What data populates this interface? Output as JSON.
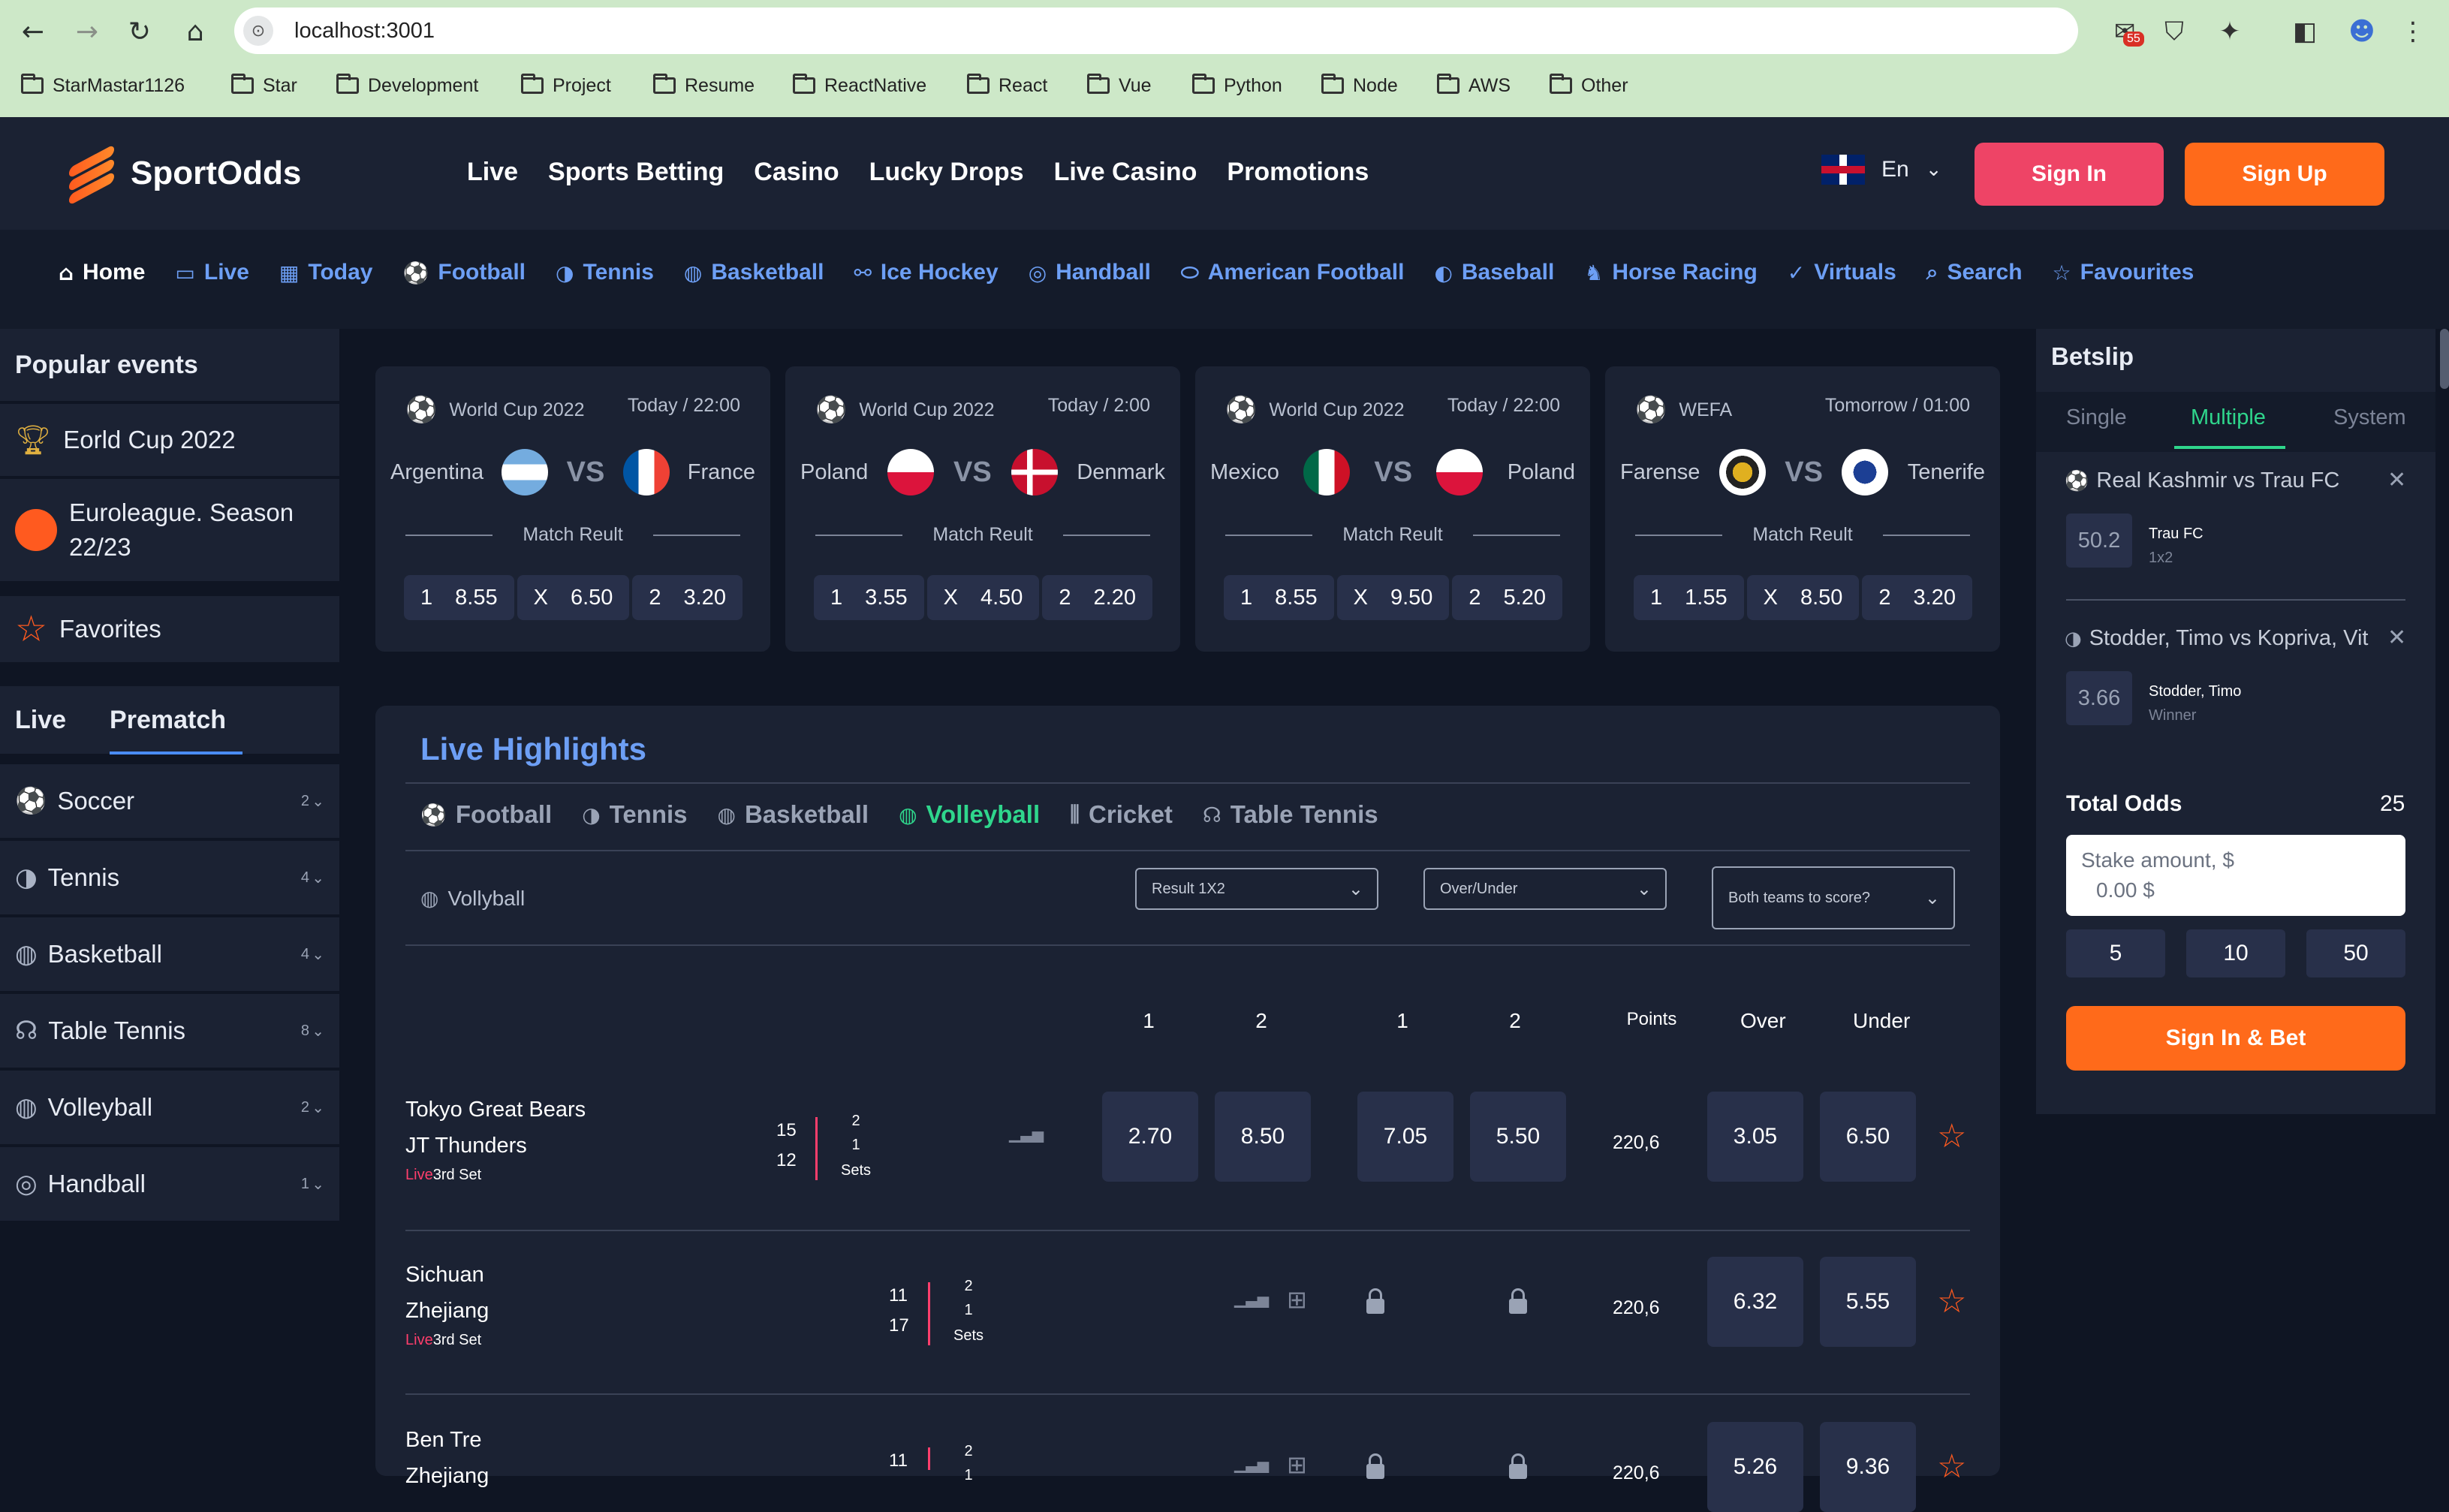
{
  "browser": {
    "url": "localhost:3001",
    "badge": "55",
    "bookmarks": [
      "StarMastar1126",
      "Star",
      "Development",
      "Project",
      "Resume",
      "ReactNative",
      "React",
      "Vue",
      "Python",
      "Node",
      "AWS",
      "Other"
    ]
  },
  "header": {
    "brand": "SportOdds",
    "nav": [
      "Live",
      "Sports Betting",
      "Casino",
      "Lucky Drops",
      "Live Casino",
      "Promotions"
    ],
    "lang": "En",
    "signin": "Sign In",
    "signup": "Sign Up"
  },
  "subnav": [
    {
      "label": "Home",
      "icon": "home-icon",
      "glyph": "⌂"
    },
    {
      "label": "Live",
      "icon": "live-icon",
      "glyph": "▭"
    },
    {
      "label": "Today",
      "icon": "calendar-icon",
      "glyph": "▦"
    },
    {
      "label": "Football",
      "icon": "football-icon",
      "glyph": "⚽"
    },
    {
      "label": "Tennis",
      "icon": "tennis-icon",
      "glyph": "◑"
    },
    {
      "label": "Basketball",
      "icon": "basketball-icon",
      "glyph": "◍"
    },
    {
      "label": "Ice Hockey",
      "icon": "hockey-icon",
      "glyph": "⚯"
    },
    {
      "label": "Handball",
      "icon": "handball-icon",
      "glyph": "◎"
    },
    {
      "label": "American Football",
      "icon": "american-football-icon",
      "glyph": "⬭"
    },
    {
      "label": "Baseball",
      "icon": "baseball-icon",
      "glyph": "◐"
    },
    {
      "label": "Horse Racing",
      "icon": "horse-icon",
      "glyph": "♞"
    },
    {
      "label": "Virtuals",
      "icon": "virtuals-icon",
      "glyph": "✓"
    },
    {
      "label": "Search",
      "icon": "search-icon",
      "glyph": "⌕"
    },
    {
      "label": "Favourites",
      "icon": "star-icon",
      "glyph": "☆"
    }
  ],
  "sidebar": {
    "title": "Popular events",
    "events": [
      "Eorld Cup 2022",
      "Euroleague. Season 22/23",
      "Favorites"
    ],
    "tabs": [
      "Live",
      "Prematch"
    ],
    "sports": [
      {
        "name": "Soccer",
        "count": "2"
      },
      {
        "name": "Tennis",
        "count": "4"
      },
      {
        "name": "Basketball",
        "count": "4"
      },
      {
        "name": "Table Tennis",
        "count": "8"
      },
      {
        "name": "Volleyball",
        "count": "2"
      },
      {
        "name": "Handball",
        "count": "1"
      }
    ]
  },
  "cards": [
    {
      "league": "World Cup 2022",
      "time": "Today / 22:00",
      "home": "Argentina",
      "away": "France",
      "vs": "VS",
      "label": "Match Reult",
      "o1": "8.55",
      "ox": "6.50",
      "o2": "3.20"
    },
    {
      "league": "World Cup 2022",
      "time": "Today / 2:00",
      "home": "Poland",
      "away": "Denmark",
      "vs": "VS",
      "label": "Match Reult",
      "o1": "3.55",
      "ox": "4.50",
      "o2": "2.20"
    },
    {
      "league": "World Cup 2022",
      "time": "Today / 22:00",
      "home": "Mexico",
      "away": "Poland",
      "vs": "VS",
      "label": "Match Reult",
      "o1": "8.55",
      "ox": "9.50",
      "o2": "5.20"
    },
    {
      "league": "WEFA",
      "time": "Tomorrow / 01:00",
      "home": "Farense",
      "away": "Tenerife",
      "vs": "VS",
      "label": "Match Reult",
      "o1": "1.55",
      "ox": "8.50",
      "o2": "3.20"
    }
  ],
  "odds_keys": {
    "one": "1",
    "x": "X",
    "two": "2"
  },
  "highlights": {
    "title": "Live Highlights",
    "tabs": [
      "Football",
      "Tennis",
      "Basketball",
      "Volleyball",
      "Cricket",
      "Table Tennis"
    ],
    "active_tab": "Volleyball",
    "sport_label": "Vollyball",
    "selects": [
      "Result 1X2",
      "Over/Under",
      "Both teams to score?"
    ],
    "columns": [
      "1",
      "2",
      "1",
      "2",
      "Points",
      "Over",
      "Under"
    ],
    "rows": [
      {
        "home": "Tokyo Great Bears",
        "away": "JT Thunders",
        "live": "Live",
        "set": "3rd Set",
        "s1": "15",
        "s2": "12",
        "set_a": "2",
        "set_b": "1",
        "sets": "Sets",
        "o1": "2.70",
        "o2": "8.50",
        "o3": "7.05",
        "o4": "5.50",
        "points": "220,6",
        "over": "3.05",
        "under": "6.50"
      },
      {
        "home": "Sichuan",
        "away": "Zhejiang",
        "live": "Live",
        "set": "3rd Set",
        "s1": "11",
        "s2": "17",
        "set_a": "2",
        "set_b": "1",
        "sets": "Sets",
        "points": "220,6",
        "over": "6.32",
        "under": "5.55"
      },
      {
        "home": "Ben Tre",
        "away": "Zhejiang",
        "s1": "11",
        "set_a": "2",
        "set_b": "1",
        "points": "220,6",
        "over": "5.26",
        "under": "9.36"
      }
    ]
  },
  "betslip": {
    "title": "Betslip",
    "tabs": [
      "Single",
      "Multiple",
      "System"
    ],
    "active": "Multiple",
    "bets": [
      {
        "title": "Real Kashmir vs Trau FC",
        "odd": "50.2",
        "pick": "Trau FC",
        "market": "1x2"
      },
      {
        "title": "Stodder, Timo vs Kopriva, Vit",
        "odd": "3.66",
        "pick": "Stodder, Timo",
        "market": "Winner"
      }
    ],
    "total_label": "Total Odds",
    "total": "25",
    "stake_placeholder": "Stake amount, $",
    "stake_value": "0.00 $",
    "quick": [
      "5",
      "10",
      "50"
    ],
    "cta": "Sign In & Bet"
  }
}
